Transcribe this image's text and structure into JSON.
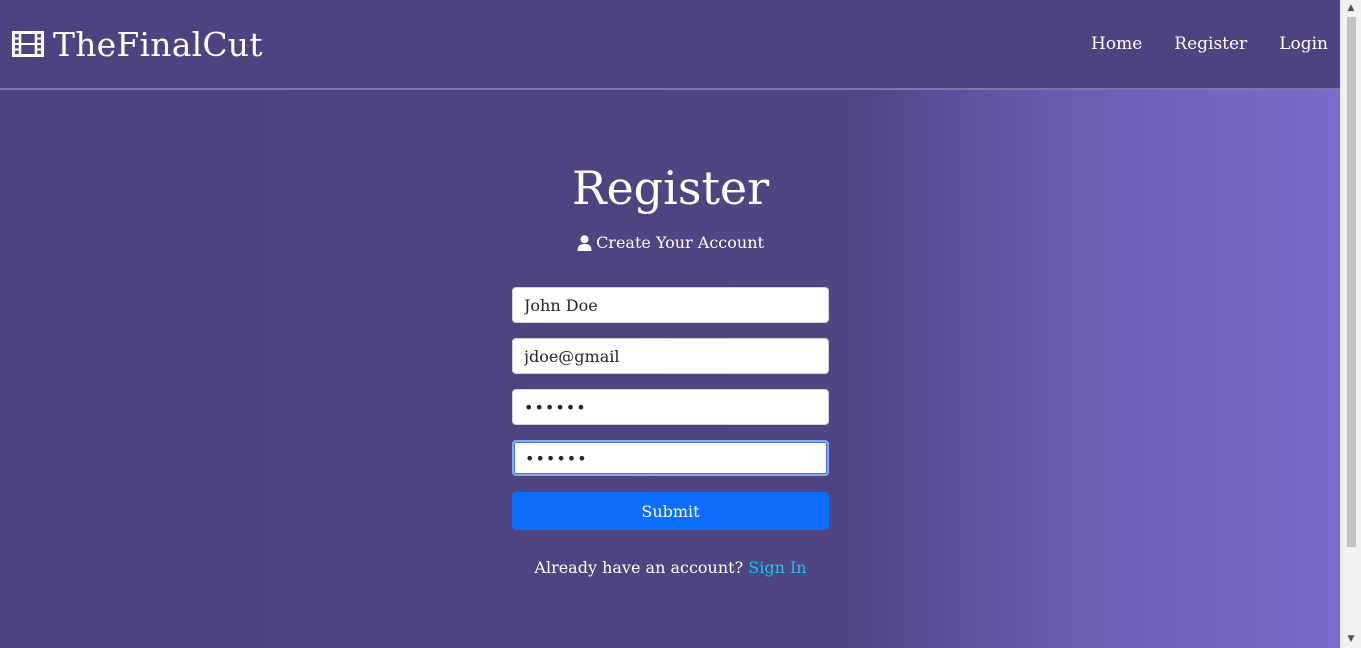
{
  "nav": {
    "brand": "TheFinalCut",
    "links": [
      "Home",
      "Register",
      "Login"
    ]
  },
  "page": {
    "title": "Register",
    "subtitle": "Create Your Account"
  },
  "form": {
    "name_value": "John Doe",
    "email_value": "jdoe@gmail",
    "password_value": "••••••",
    "confirm_value": "••••••",
    "submit_label": "Submit"
  },
  "footer": {
    "prompt": "Already have an account?",
    "link": "Sign In"
  },
  "icons": {
    "brand": "film-icon",
    "subtitle": "user-icon"
  },
  "colors": {
    "navbar": "#4c4380",
    "submit": "#0d6efd",
    "link": "#1ec1f5"
  }
}
